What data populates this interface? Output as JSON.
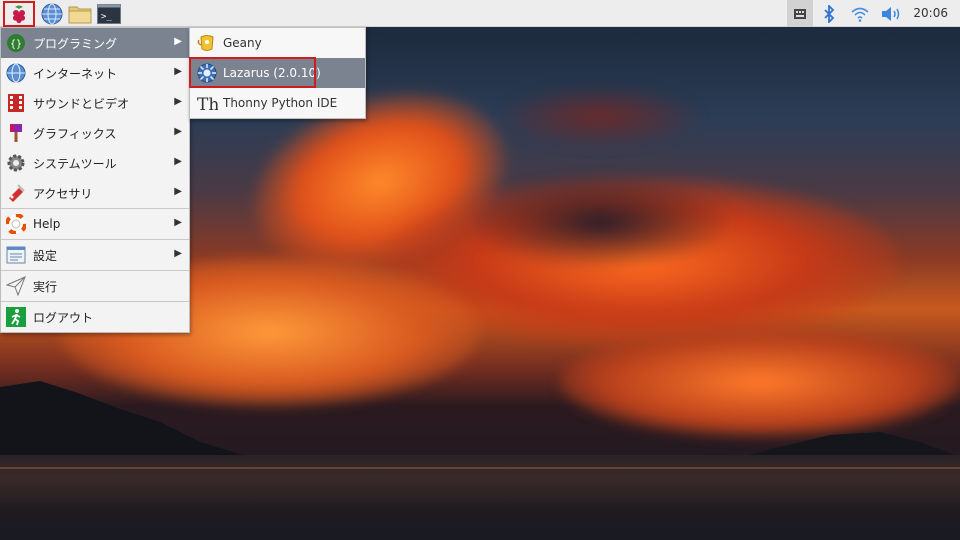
{
  "panel": {
    "launchers": [
      "raspberry-icon",
      "globe-icon",
      "folder-icon",
      "terminal-icon"
    ],
    "tray_icons": [
      "keyboard-icon",
      "bluetooth-icon",
      "wifi-icon",
      "volume-icon"
    ],
    "clock": "20:06"
  },
  "menu": {
    "items": [
      {
        "label": "プログラミング",
        "icon": "programming-icon",
        "has_submenu": true,
        "selected": true
      },
      {
        "label": "インターネット",
        "icon": "internet-icon",
        "has_submenu": true
      },
      {
        "label": "サウンドとビデオ",
        "icon": "sound-video-icon",
        "has_submenu": true
      },
      {
        "label": "グラフィックス",
        "icon": "graphics-icon",
        "has_submenu": true
      },
      {
        "label": "システムツール",
        "icon": "system-tools-icon",
        "has_submenu": true
      },
      {
        "label": "アクセサリ",
        "icon": "accessories-icon",
        "has_submenu": true
      },
      {
        "label": "Help",
        "icon": "help-icon",
        "has_submenu": true
      },
      {
        "label": "設定",
        "icon": "settings-icon",
        "has_submenu": true
      },
      {
        "label": "実行",
        "icon": "run-icon",
        "has_submenu": false
      },
      {
        "label": "ログアウト",
        "icon": "logout-icon",
        "has_submenu": false
      }
    ],
    "arrow_glyph": "▶"
  },
  "submenu": {
    "items": [
      {
        "label": "Geany",
        "icon": "geany-icon"
      },
      {
        "label": "Lazarus (2.0.10)",
        "icon": "lazarus-icon",
        "highlighted": true
      },
      {
        "label": "Thonny Python IDE",
        "icon": "thonny-icon"
      }
    ]
  },
  "colors": {
    "selection": "#7b8390",
    "highlight_box": "#d01c1c",
    "panel_bg": "#ededed"
  }
}
